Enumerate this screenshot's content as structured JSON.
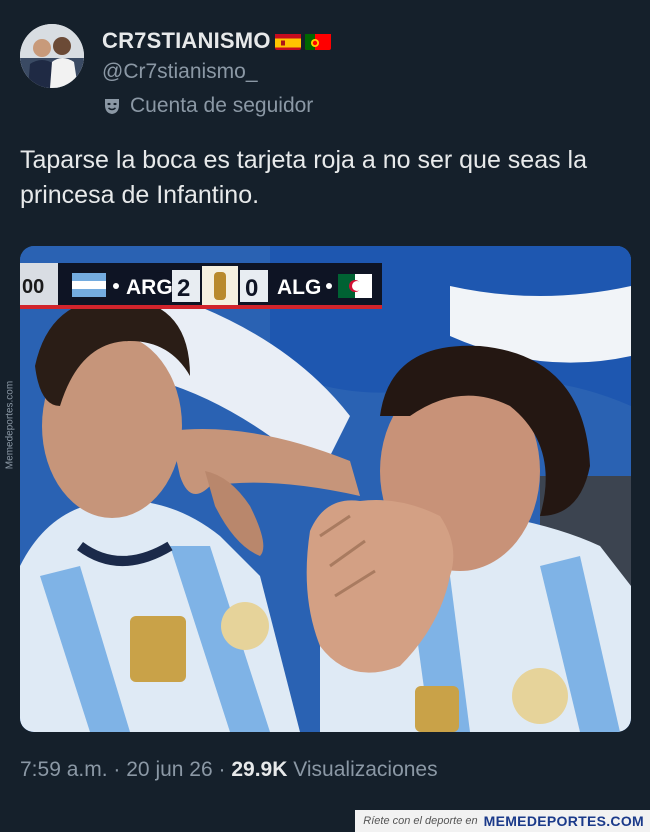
{
  "tweet": {
    "display_name": "CR7STIANISMO",
    "flags": [
      "spain-flag",
      "portugal-flag"
    ],
    "handle": "@Cr7stianismo_",
    "account_label": "Cuenta de seguidor",
    "text": "Taparse la boca es tarjeta roja a no ser que seas la princesa de Infantino.",
    "time": "7:59 a.m.",
    "separator": "·",
    "date": "20 jun 26",
    "views_count": "29.9K",
    "views_label": "Visualizaciones"
  },
  "media": {
    "scoreboard": {
      "clock": "00",
      "home_team": "ARG",
      "home_score": "2",
      "away_score": "0",
      "away_team": "ALG"
    }
  },
  "watermark": {
    "side_text": "Memedeportes.com",
    "footer_tagline": "Ríete con el deporte en",
    "footer_brand": "MEMEDEPORTES.COM"
  },
  "colors": {
    "background": "#15202b",
    "text_primary": "#e7e9ea",
    "text_secondary": "#8b98a5"
  }
}
